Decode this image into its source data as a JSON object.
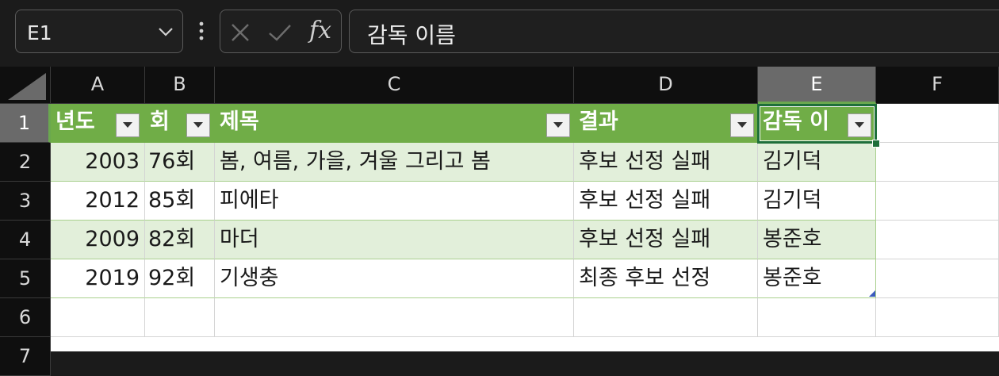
{
  "formula_bar": {
    "name_box": "E1",
    "cancel_icon": "close-icon",
    "enter_icon": "check-icon",
    "function_label": "fx",
    "formula_value": "감독 이름"
  },
  "columns": [
    "A",
    "B",
    "C",
    "D",
    "E",
    "F"
  ],
  "rows": [
    "1",
    "2",
    "3",
    "4",
    "5",
    "6",
    "7"
  ],
  "selected_cell": "E1",
  "table": {
    "headers": [
      "년도",
      "회",
      "제목",
      "결과",
      "감독 이름"
    ],
    "header_visible": [
      "년도",
      "회",
      "제목",
      "결과",
      "감독 이"
    ],
    "data": [
      [
        "2003",
        "76회",
        "봄, 여름, 가을, 겨울 그리고 봄",
        "후보 선정 실패",
        "김기덕"
      ],
      [
        "2012",
        "85회",
        "피에타",
        "후보 선정 실패",
        "김기덕"
      ],
      [
        "2009",
        "82회",
        "마더",
        "후보 선정 실패",
        "봉준호"
      ],
      [
        "2019",
        "92회",
        "기생충",
        "최종 후보 선정",
        "봉준호"
      ]
    ]
  },
  "colors": {
    "table_header": "#70ad47",
    "table_band": "#e2efda",
    "selection": "#1e6f3a"
  }
}
